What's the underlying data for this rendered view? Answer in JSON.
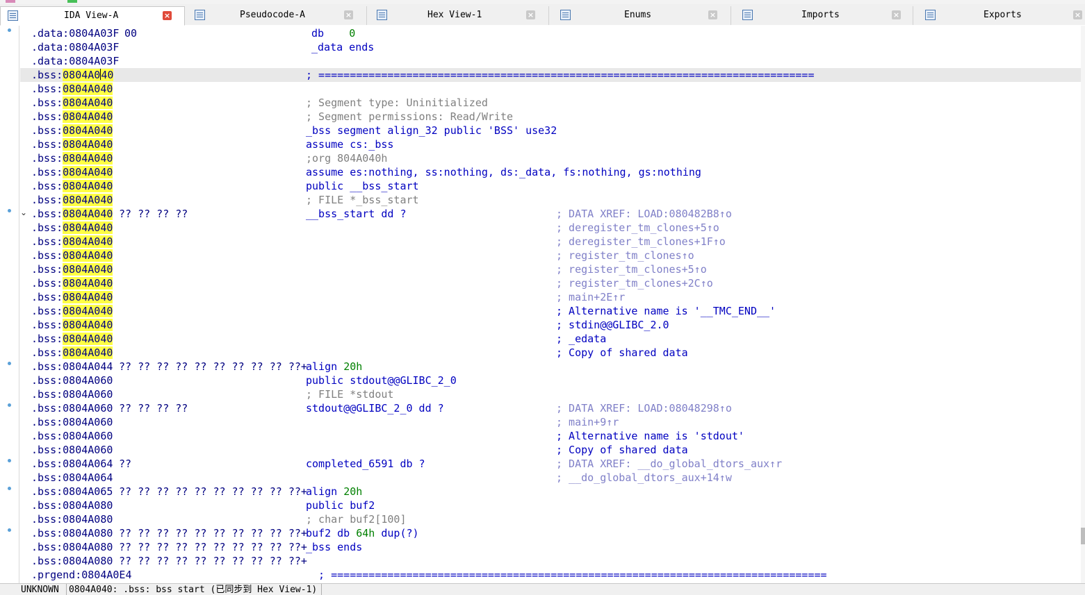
{
  "tabs": [
    {
      "label": "IDA View-A",
      "icon": "ida-view-icon",
      "active": true
    },
    {
      "label": "Pseudocode-A",
      "icon": "pseudocode-icon",
      "active": false
    },
    {
      "label": "Hex View-1",
      "icon": "hex-view-icon",
      "active": false
    },
    {
      "label": "Enums",
      "icon": "enums-icon",
      "active": false
    },
    {
      "label": "Imports",
      "icon": "imports-icon",
      "active": false
    },
    {
      "label": "Exports",
      "icon": "exports-icon",
      "active": false
    }
  ],
  "close_glyph": "×",
  "chevron_glyph": "⌄",
  "listing": [
    {
      "seg": ".data:",
      "addr": "0804A03F",
      "bytes": "00",
      "instr": "db    ",
      "num": "0",
      "cmt": ""
    },
    {
      "seg": ".data:",
      "addr": "0804A03F",
      "bytes": "",
      "instr": "_data ends",
      "cmt": ""
    },
    {
      "seg": ".data:",
      "addr": "0804A03F",
      "bytes": "",
      "instr": "",
      "cmt": ""
    },
    {
      "seg": ".bss:",
      "addr": "0804A040",
      "bytes": "",
      "instr": "; ===============================================================================",
      "cmt": ""
    },
    {
      "seg": ".bss:",
      "addr": "0804A040",
      "bytes": "",
      "instr": "",
      "cmt": ""
    },
    {
      "seg": ".bss:",
      "addr": "0804A040",
      "bytes": "",
      "instr": "; Segment type: Uninitialized",
      "cmt": ""
    },
    {
      "seg": ".bss:",
      "addr": "0804A040",
      "bytes": "",
      "instr": "; Segment permissions: Read/Write",
      "cmt": ""
    },
    {
      "seg": ".bss:",
      "addr": "0804A040",
      "bytes": "",
      "instr": "_bss segment align_32 public 'BSS' use32",
      "cmt": ""
    },
    {
      "seg": ".bss:",
      "addr": "0804A040",
      "bytes": "",
      "instr": "assume cs:_bss",
      "cmt": ""
    },
    {
      "seg": ".bss:",
      "addr": "0804A040",
      "bytes": "",
      "instr": ";org 804A040h",
      "cmt": ""
    },
    {
      "seg": ".bss:",
      "addr": "0804A040",
      "bytes": "",
      "instr": "assume es:nothing, ss:nothing, ds:_data, fs:nothing, gs:nothing",
      "cmt": ""
    },
    {
      "seg": ".bss:",
      "addr": "0804A040",
      "bytes": "",
      "instr": "public __bss_start",
      "cmt": ""
    },
    {
      "seg": ".bss:",
      "addr": "0804A040",
      "bytes": "",
      "instr": "; FILE *_bss_start",
      "cmt": ""
    },
    {
      "seg": ".bss:",
      "addr": "0804A040",
      "bytes": "?? ?? ?? ??",
      "instr": "__bss_start dd ?",
      "cmt": "; DATA XREF: LOAD:080482B8↑o"
    },
    {
      "seg": ".bss:",
      "addr": "0804A040",
      "bytes": "",
      "instr": "",
      "cmt": "; deregister_tm_clones+5↑o"
    },
    {
      "seg": ".bss:",
      "addr": "0804A040",
      "bytes": "",
      "instr": "",
      "cmt": "; deregister_tm_clones+1F↑o"
    },
    {
      "seg": ".bss:",
      "addr": "0804A040",
      "bytes": "",
      "instr": "",
      "cmt": "; register_tm_clones↑o"
    },
    {
      "seg": ".bss:",
      "addr": "0804A040",
      "bytes": "",
      "instr": "",
      "cmt": "; register_tm_clones+5↑o"
    },
    {
      "seg": ".bss:",
      "addr": "0804A040",
      "bytes": "",
      "instr": "",
      "cmt": "; register_tm_clones+2C↑o"
    },
    {
      "seg": ".bss:",
      "addr": "0804A040",
      "bytes": "",
      "instr": "",
      "cmt": "; main+2E↑r"
    },
    {
      "seg": ".bss:",
      "addr": "0804A040",
      "bytes": "",
      "instr": "",
      "cmt": "; Alternative name is '__TMC_END__'"
    },
    {
      "seg": ".bss:",
      "addr": "0804A040",
      "bytes": "",
      "instr": "",
      "cmt": "; stdin@@GLIBC_2.0"
    },
    {
      "seg": ".bss:",
      "addr": "0804A040",
      "bytes": "",
      "instr": "",
      "cmt": "; _edata"
    },
    {
      "seg": ".bss:",
      "addr": "0804A040",
      "bytes": "",
      "instr": "",
      "cmt": "; Copy of shared data"
    },
    {
      "seg": ".bss:",
      "addr": "0804A044",
      "bytes": "?? ?? ?? ?? ?? ?? ?? ?? ?? ??+",
      "instr": "align ",
      "num": "20h",
      "cmt": ""
    },
    {
      "seg": ".bss:",
      "addr": "0804A060",
      "bytes": "",
      "instr": "public stdout@@GLIBC_2_0",
      "cmt": ""
    },
    {
      "seg": ".bss:",
      "addr": "0804A060",
      "bytes": "",
      "instr": "; FILE *stdout",
      "cmt": ""
    },
    {
      "seg": ".bss:",
      "addr": "0804A060",
      "bytes": "?? ?? ?? ??",
      "instr": "stdout@@GLIBC_2_0 dd ?",
      "cmt": "; DATA XREF: LOAD:08048298↑o"
    },
    {
      "seg": ".bss:",
      "addr": "0804A060",
      "bytes": "",
      "instr": "",
      "cmt": "; main+9↑r"
    },
    {
      "seg": ".bss:",
      "addr": "0804A060",
      "bytes": "",
      "instr": "",
      "cmt": "; Alternative name is 'stdout'"
    },
    {
      "seg": ".bss:",
      "addr": "0804A060",
      "bytes": "",
      "instr": "",
      "cmt": "; Copy of shared data"
    },
    {
      "seg": ".bss:",
      "addr": "0804A064",
      "bytes": "??",
      "instr": "completed_6591 db ?",
      "cmt": "; DATA XREF: __do_global_dtors_aux↑r"
    },
    {
      "seg": ".bss:",
      "addr": "0804A064",
      "bytes": "",
      "instr": "",
      "cmt": "; __do_global_dtors_aux+14↑w"
    },
    {
      "seg": ".bss:",
      "addr": "0804A065",
      "bytes": "?? ?? ?? ?? ?? ?? ?? ?? ?? ??+",
      "instr": "align ",
      "num": "20h",
      "cmt": ""
    },
    {
      "seg": ".bss:",
      "addr": "0804A080",
      "bytes": "",
      "instr": "public buf2",
      "cmt": ""
    },
    {
      "seg": ".bss:",
      "addr": "0804A080",
      "bytes": "",
      "instr": "; char buf2[100]",
      "cmt": ""
    },
    {
      "seg": ".bss:",
      "addr": "0804A080",
      "bytes": "?? ?? ?? ?? ?? ?? ?? ?? ?? ??+",
      "instr": "buf2 db ",
      "num": "64h",
      "instr_tail": " dup(?)",
      "cmt": ""
    },
    {
      "seg": ".bss:",
      "addr": "0804A080",
      "bytes": "?? ?? ?? ?? ?? ?? ?? ?? ?? ??+",
      "instr": "_bss ends",
      "cmt": ""
    },
    {
      "seg": ".bss:",
      "addr": "0804A080",
      "bytes": "?? ?? ?? ?? ?? ?? ?? ?? ?? ??+",
      "instr": "",
      "cmt": ""
    },
    {
      "seg": ".prgend:",
      "addr": "0804A0E4",
      "bytes": "",
      "instr": "  ; ===============================================================================",
      "cmt": ""
    }
  ],
  "status": {
    "mode": "UNKNOWN",
    "location": "0804A040: .bss: bss start (已同步到 Hex View-1)"
  },
  "colors": {
    "address_highlight": "#ffff44",
    "instruction": "#0000c0",
    "number": "#008000",
    "comment": "#8080c8",
    "gutter_dot": "#5aa0d8",
    "active_close": "#e04a3a"
  }
}
